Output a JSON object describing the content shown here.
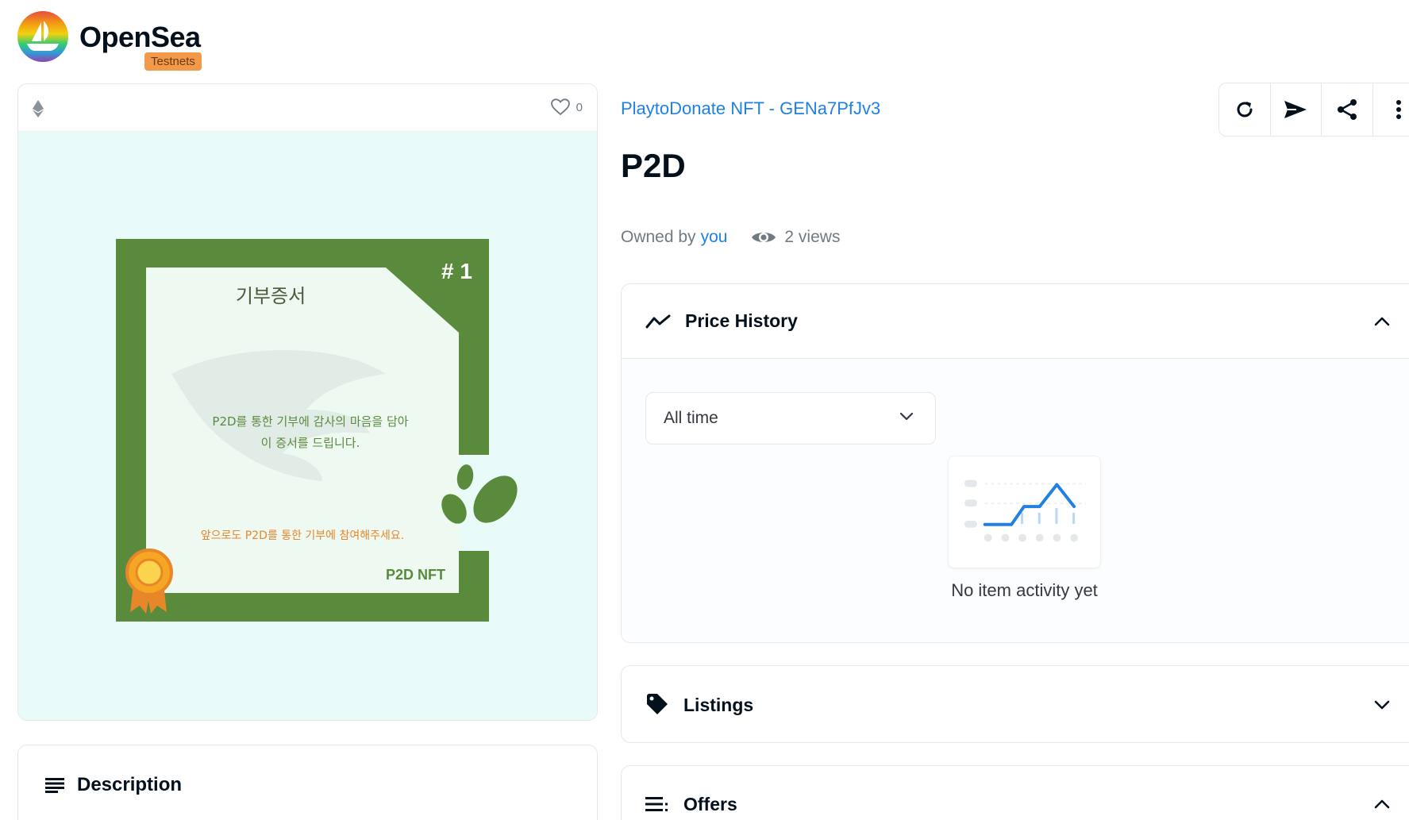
{
  "header": {
    "brand_name": "OpenSea",
    "badge": "Testnets"
  },
  "media": {
    "favorite_count": "0",
    "certificate": {
      "number": "# 1",
      "title": "기부증서",
      "body_line1": "P2D를 통한 기부에 감사의 마음을 담아",
      "body_line2": "이 증서를 드립니다.",
      "footer_note": "앞으로도 P2D를 통한 기부에 참여해주세요.",
      "brand": "P2D NFT",
      "frame_color": "#5a8a3c",
      "accent_color": "#e8862a"
    }
  },
  "description": {
    "label": "Description"
  },
  "item": {
    "collection": "PlaytoDonate NFT - GENa7PfJv3",
    "title": "P2D",
    "owned_by_label": "Owned by",
    "owner": "you",
    "views": "2 views"
  },
  "actions": [
    "refresh-icon",
    "transfer-icon",
    "share-icon",
    "more-icon"
  ],
  "price_history": {
    "label": "Price History",
    "time_filter": "All time",
    "empty_message": "No item activity yet"
  },
  "listings": {
    "label": "Listings"
  },
  "offers": {
    "label": "Offers"
  },
  "colors": {
    "link": "#2081e2",
    "heading": "#04111d",
    "muted": "#707a83",
    "media_bg": "#e9fbf9",
    "border": "#e5e8eb"
  }
}
